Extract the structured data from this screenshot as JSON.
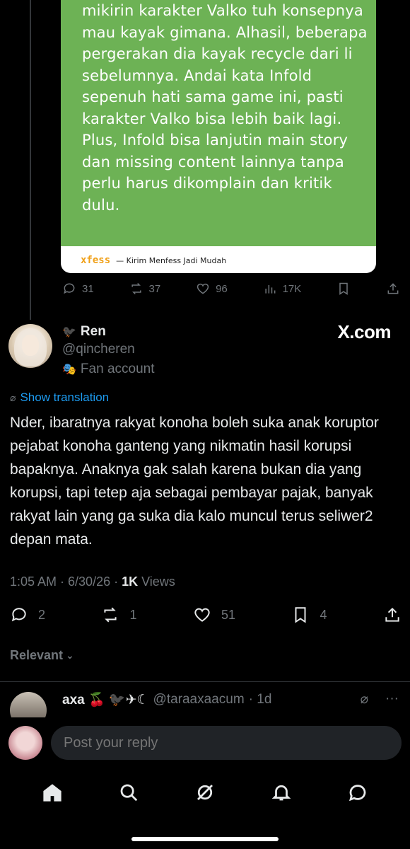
{
  "quoted_card": {
    "text": "mikirin karakter Valko tuh konsepnya mau kayak gimana. Alhasil, beberapa pergerakan dia kayak recycle dari li sebelumnya. Andai kata Infold sepenuh hati sama game ini, pasti karakter Valko bisa lebih baik lagi. Plus, Infold bisa lanjutin main story dan missing content lainnya tanpa perlu harus dikomplain dan kritik dulu.",
    "brand": "xfess",
    "tagline": "— Kirim Menfess Jadi Mudah",
    "bg_color": "#6db255"
  },
  "quoted_actions": {
    "replies": "31",
    "reposts": "37",
    "likes": "96",
    "views": "17K"
  },
  "tweet": {
    "name": "Ren",
    "handle": "@qincheren",
    "fan_label": "Fan account",
    "watermark": "X.com",
    "translate": "Show translation",
    "body": "Nder, ibaratnya rakyat konoha boleh suka anak koruptor pejabat konoha ganteng yang nikmatin hasil korupsi bapaknya. Anaknya gak salah karena bukan dia yang korupsi, tapi tetep aja sebagai pembayar pajak, banyak rakyat lain yang ga suka dia kalo muncul terus seliwer2 depan mata.",
    "time": "1:05 AM · 6/30/26 · ",
    "views_count": "1K",
    "views_label": " Views"
  },
  "tweet_actions": {
    "replies": "2",
    "reposts": "1",
    "likes": "51",
    "bookmarks": "4"
  },
  "sort": {
    "label": "Relevant"
  },
  "reply_preview": {
    "name": "axa 🍒 🐦‍⬛✈☾",
    "handle": "@taraaxaacum",
    "age": "· 1d"
  },
  "reply_box": {
    "placeholder": "Post your reply"
  },
  "nav": [
    "home-icon",
    "search-icon",
    "grok-icon",
    "notifications-icon",
    "messages-icon"
  ],
  "colors": {
    "accent": "#1d9bf0",
    "muted": "#71767b",
    "text": "#e7e9ea"
  }
}
